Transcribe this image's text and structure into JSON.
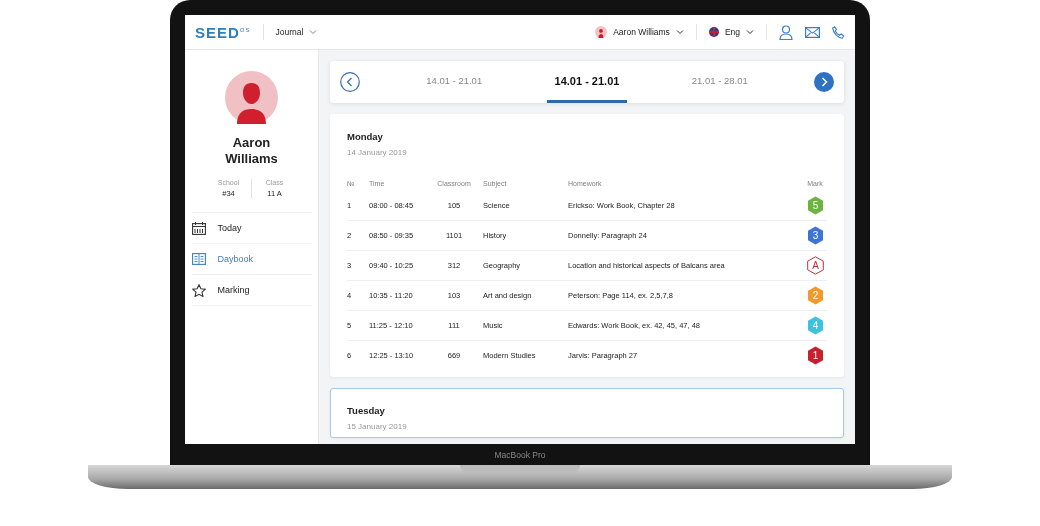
{
  "header": {
    "logo": "SEED",
    "logo_sup": "OS",
    "menu": "Journal",
    "user": "Aaron Williams",
    "language": "Eng"
  },
  "profile": {
    "name": "Aaron Williams",
    "stats": [
      {
        "label": "School",
        "value": "#34"
      },
      {
        "label": "Class",
        "value": "11 A"
      }
    ]
  },
  "sidebar": {
    "items": [
      {
        "label": "Today",
        "kind": "calendar",
        "selected": false
      },
      {
        "label": "Daybook",
        "kind": "book",
        "selected": true
      },
      {
        "label": "Marking",
        "kind": "star",
        "selected": false
      }
    ]
  },
  "weeks": [
    {
      "label": "14.01 - 21.01",
      "selected": false
    },
    {
      "label": "14.01 - 21.01",
      "selected": true
    },
    {
      "label": "21.01 - 28.01",
      "selected": false
    }
  ],
  "days": [
    {
      "day": "Monday",
      "date": "14 January 2019",
      "highlighted": false,
      "columns": [
        "№",
        "Time",
        "Classroom",
        "Subject",
        "Homework",
        "Mark"
      ],
      "rows": [
        {
          "n": "1",
          "time": "08:00 - 08:45",
          "room": "105",
          "subject": "Science",
          "homework": "Erickso: Work Book, Chapter 28",
          "mark": {
            "text": "5",
            "kind": "hexagon",
            "color": "#6db33f"
          }
        },
        {
          "n": "2",
          "time": "08:50 - 09:35",
          "room": "1101",
          "subject": "History",
          "homework": "Donnelly: Paragraph 24",
          "mark": {
            "text": "3",
            "kind": "hexagon",
            "color": "#3f73d6"
          }
        },
        {
          "n": "3",
          "time": "09:40 - 10:25",
          "room": "312",
          "subject": "Geography",
          "homework": "Location and historical aspects of Balcans area",
          "mark": {
            "text": "A",
            "kind": "outline",
            "color": "#c0303a"
          }
        },
        {
          "n": "4",
          "time": "10:35 - 11:20",
          "room": "103",
          "subject": "Art and design",
          "homework": "Peterson: Page 114, ex. 2,5,7,8",
          "mark": {
            "text": "2",
            "kind": "hexagon",
            "color": "#f09a2e"
          }
        },
        {
          "n": "5",
          "time": "11:25 - 12:10",
          "room": "111",
          "subject": "Music",
          "homework": "Edwards: Work Book, ex. 42, 45, 47, 48",
          "mark": {
            "text": "4",
            "kind": "hexagon",
            "color": "#3cc2e0"
          }
        },
        {
          "n": "6",
          "time": "12:25 - 13:10",
          "room": "669",
          "subject": "Modern Studies",
          "homework": "Jarvis: Paragraph 27",
          "mark": {
            "text": "1",
            "kind": "hexagon",
            "color": "#c8202e"
          }
        }
      ]
    },
    {
      "day": "Tuesday",
      "date": "15 January 2019",
      "highlighted": true
    }
  ],
  "device_label": "MacBook Pro"
}
